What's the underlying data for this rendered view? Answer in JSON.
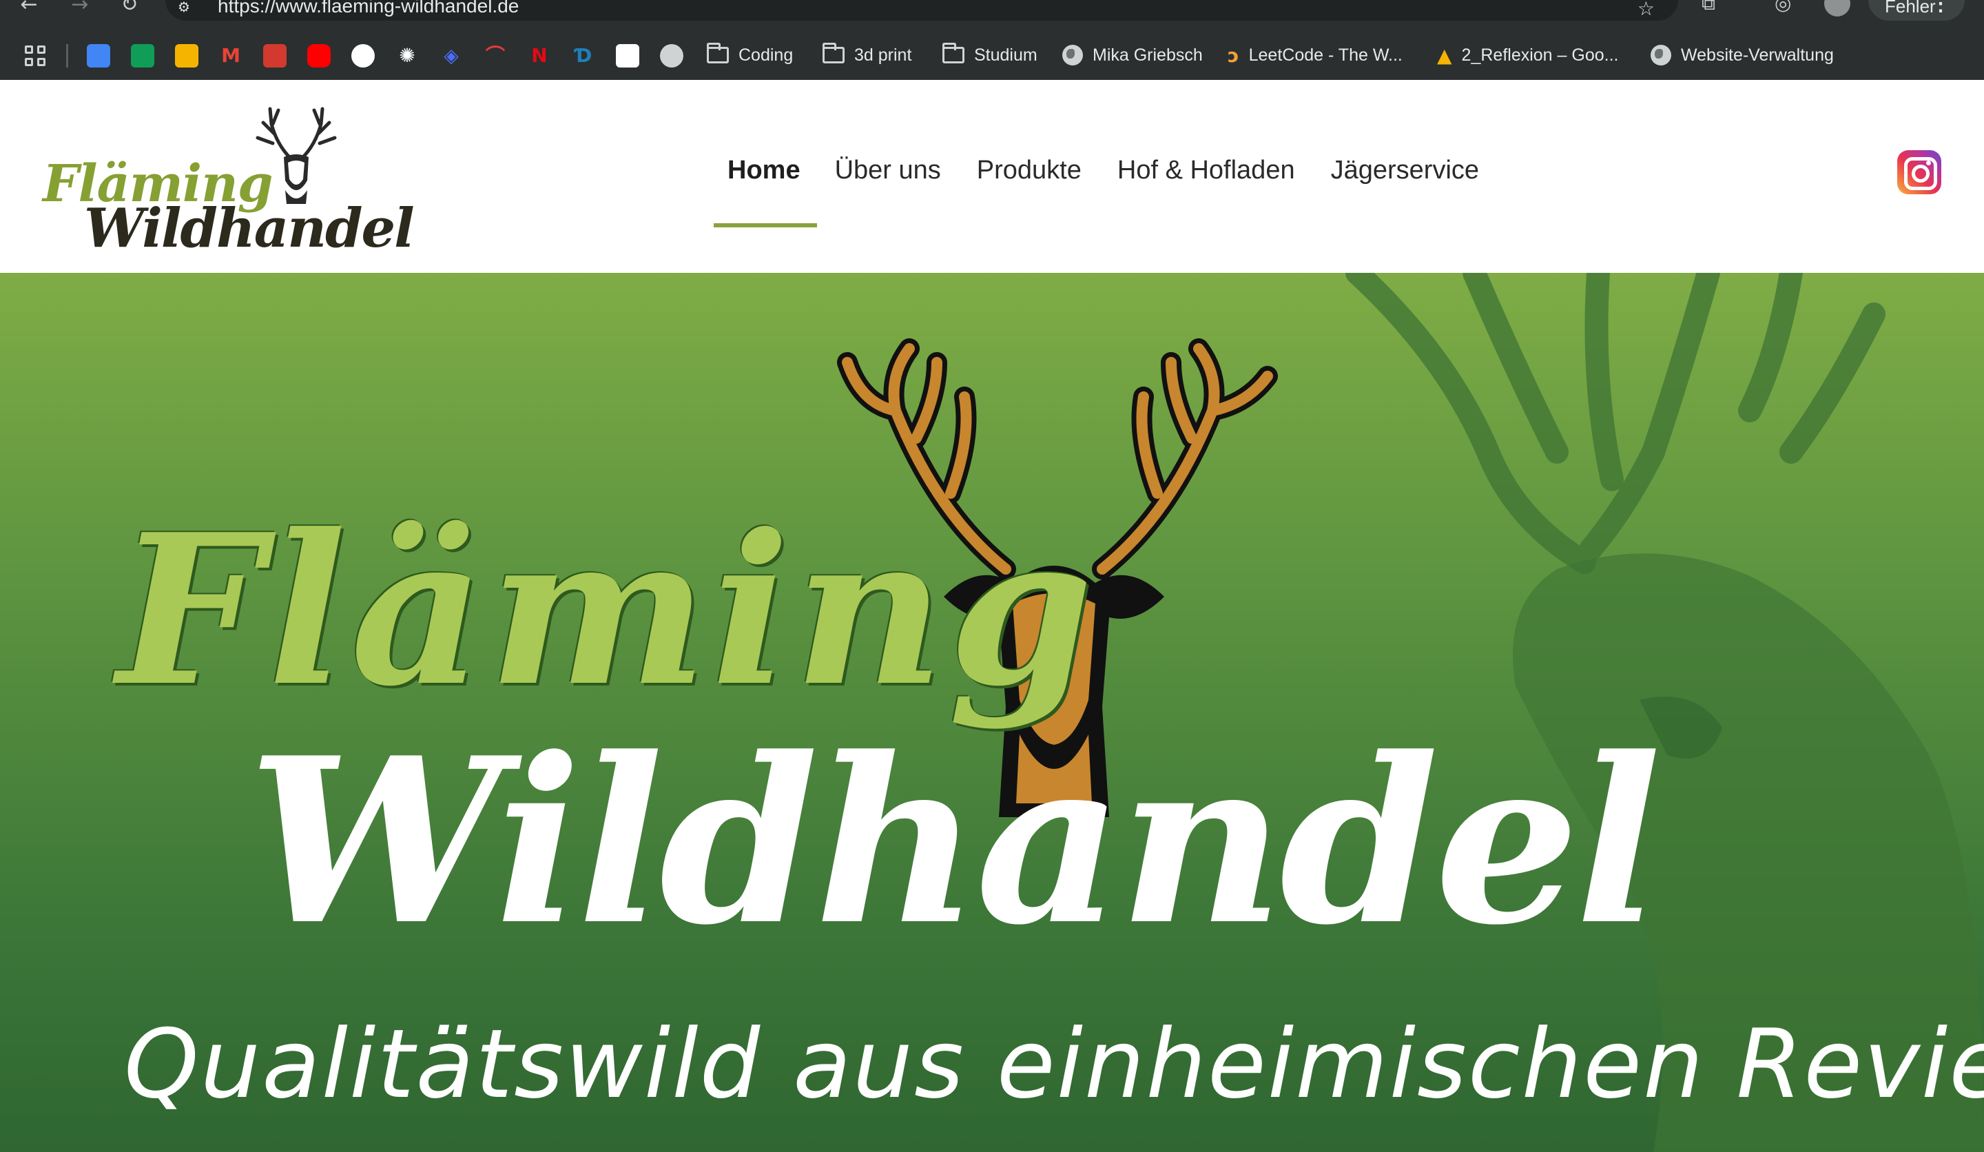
{
  "browser": {
    "url": "https://www.flaeming-wildhandel.de",
    "error_label": "Fehler",
    "menu_glyph": "⋮"
  },
  "bookmarks": {
    "favicons": [
      {
        "name": "google-docs",
        "color": "#4285f4"
      },
      {
        "name": "google-sheets",
        "color": "#0f9d58"
      },
      {
        "name": "google-slides",
        "color": "#f4b400"
      },
      {
        "name": "gmail",
        "color": "#ea4335"
      },
      {
        "name": "bibox",
        "color": "#d23a2f"
      },
      {
        "name": "youtube",
        "color": "#ff0000"
      },
      {
        "name": "github",
        "color": "#ffffff"
      },
      {
        "name": "openai",
        "color": "#ffffff"
      },
      {
        "name": "deepl",
        "color": "#4a6cf7"
      },
      {
        "name": "red-app",
        "color": "#e23b3b"
      },
      {
        "name": "netflix",
        "color": "#e50914"
      },
      {
        "name": "blue-app",
        "color": "#1f7fb8"
      },
      {
        "name": "amazon",
        "color": "#ffffff"
      },
      {
        "name": "circle-app",
        "color": "#cfd3d4"
      }
    ],
    "items": [
      {
        "label": "Coding",
        "icon": "folder-icon"
      },
      {
        "label": "3d print",
        "icon": "folder-icon"
      },
      {
        "label": "Studium",
        "icon": "folder-icon"
      },
      {
        "label": "Mika Griebsch",
        "icon": "globe-icon"
      },
      {
        "label": "LeetCode - The W...",
        "icon": "leetcode-icon"
      },
      {
        "label": "2_Reflexion – Goo...",
        "icon": "google-drive-icon"
      },
      {
        "label": "Website-Verwaltung",
        "icon": "globe-icon"
      }
    ]
  },
  "site": {
    "logo_script": "Fläming",
    "logo_word": "Wildhandel",
    "nav": [
      {
        "label": "Home",
        "active": true
      },
      {
        "label": "Über uns",
        "active": false
      },
      {
        "label": "Produkte",
        "active": false
      },
      {
        "label": "Hof & Hofladen",
        "active": false
      },
      {
        "label": "Jägerservice",
        "active": false
      }
    ],
    "accent_color": "#8aa33a",
    "social_icon": "instagram-icon"
  },
  "hero": {
    "title_script": "Fläming",
    "title_word": "Wildhandel",
    "tagline": "Qualitätswild aus einheimischen Revieren",
    "bg_color": "#4a8a3a"
  }
}
